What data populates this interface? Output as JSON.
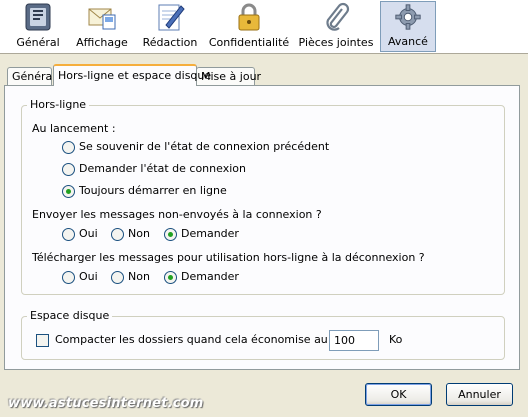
{
  "toolbar": {
    "items": [
      {
        "label": "Général",
        "icon": "general-icon"
      },
      {
        "label": "Affichage",
        "icon": "display-icon"
      },
      {
        "label": "Rédaction",
        "icon": "compose-icon"
      },
      {
        "label": "Confidentialité",
        "icon": "lock-icon"
      },
      {
        "label": "Pièces jointes",
        "icon": "paperclip-icon"
      },
      {
        "label": "Avancé",
        "icon": "gear-icon",
        "active": true
      }
    ]
  },
  "tabs": [
    {
      "label": "Général"
    },
    {
      "label": "Hors-ligne et espace disque",
      "selected": true
    },
    {
      "label": "Mise à jour"
    }
  ],
  "offline": {
    "legend": "Hors-ligne",
    "startup_label": "Au lancement :",
    "startup_options": [
      {
        "label": "Se souvenir de l'état de connexion précédent",
        "checked": false
      },
      {
        "label": "Demander l'état de connexion",
        "checked": false
      },
      {
        "label": "Toujours démarrer en ligne",
        "checked": true
      }
    ],
    "send_label": "Envoyer les messages non-envoyés à la connexion ?",
    "send_options": [
      {
        "label": "Oui",
        "checked": false
      },
      {
        "label": "Non",
        "checked": false
      },
      {
        "label": "Demander",
        "checked": true
      }
    ],
    "download_label": "Télécharger les messages pour utilisation hors-ligne à la déconnexion ?",
    "download_options": [
      {
        "label": "Oui",
        "checked": false
      },
      {
        "label": "Non",
        "checked": false
      },
      {
        "label": "Demander",
        "checked": true
      }
    ]
  },
  "disk": {
    "legend": "Espace disque",
    "compact_label": "Compacter les dossiers quand cela économise au moins",
    "compact_checked": false,
    "compact_value": "100",
    "unit": "Ko"
  },
  "buttons": {
    "ok": "OK",
    "cancel": "Annuler"
  },
  "watermark": "www.astucesinternet.com",
  "colors": {
    "background": "#ECE9D8",
    "tab_highlight": "#F5AE3D",
    "radio_dot": "#21A121",
    "active_toolbar_bg": "#D6DEEE"
  }
}
